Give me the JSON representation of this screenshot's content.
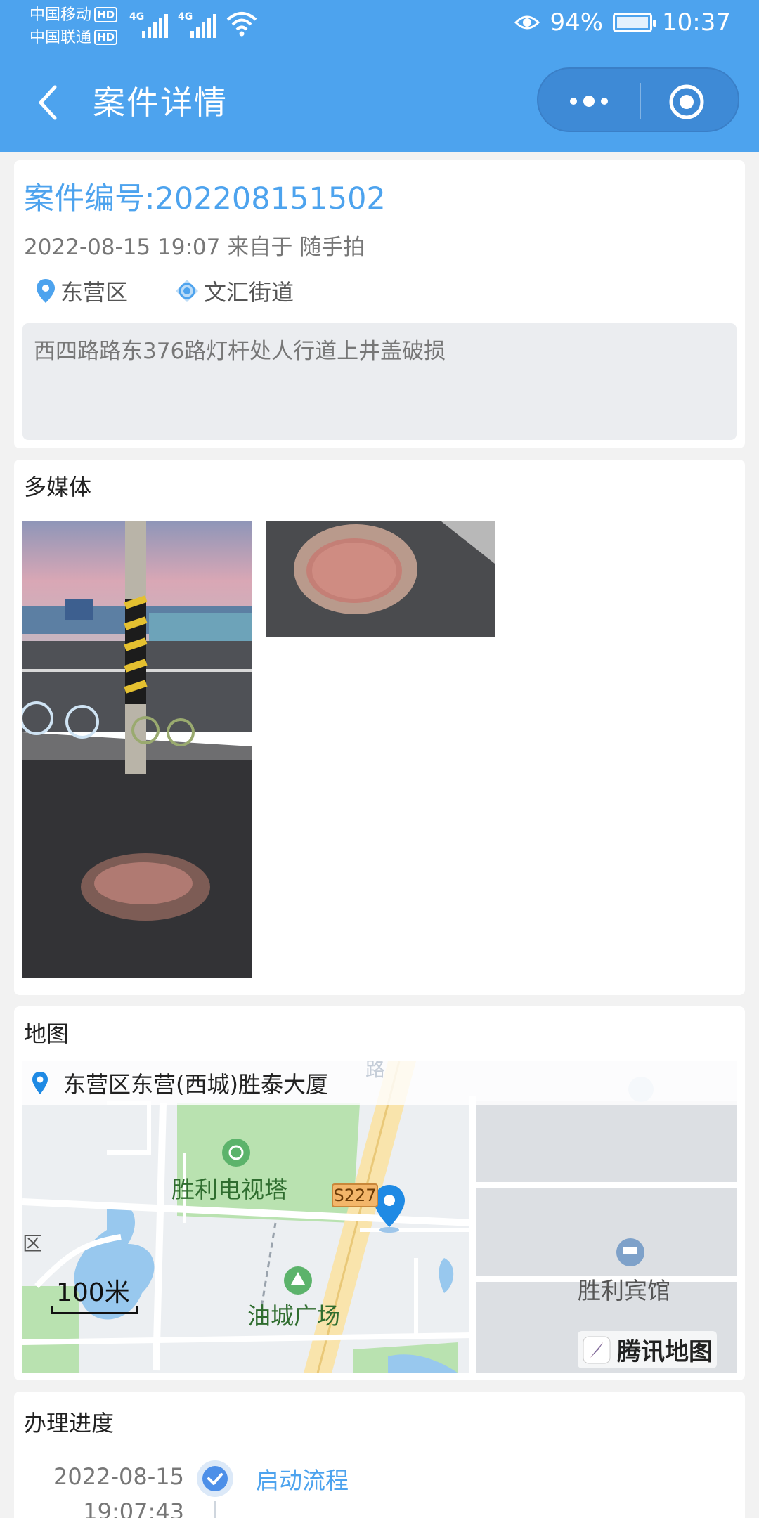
{
  "status_bar": {
    "carrier1": "中国移动",
    "carrier2": "中国联通",
    "hd": "HD",
    "net1": "4G",
    "net2": "4G",
    "battery": "94%",
    "time": "10:37"
  },
  "nav": {
    "title": "案件详情",
    "back_icon": "chevron-left-icon",
    "more_icon": "more-dots-icon",
    "close_icon": "target-circle-icon"
  },
  "case": {
    "number_label": "案件编号:202208151502",
    "datetime": "2022-08-15 19:07",
    "from_label": "来自于",
    "source": "随手拍",
    "district": "东营区",
    "street": "文汇街道",
    "description": "西四路路东376路灯杆处人行道上井盖破损"
  },
  "media": {
    "title": "多媒体"
  },
  "map": {
    "title": "地图",
    "address": "东营区东营(西城)胜泰大厦",
    "poi_tower": "胜利电视塔",
    "poi_square": "油城广场",
    "poi_hotel": "胜利宾馆",
    "road_top": "路",
    "road_code": "S227",
    "edge_label": "区",
    "scale": "100米",
    "provider": "腾讯地图"
  },
  "progress": {
    "title": "办理进度",
    "steps": [
      {
        "date": "2022-08-15",
        "time": "19:07:43",
        "label": "启动流程"
      }
    ]
  }
}
